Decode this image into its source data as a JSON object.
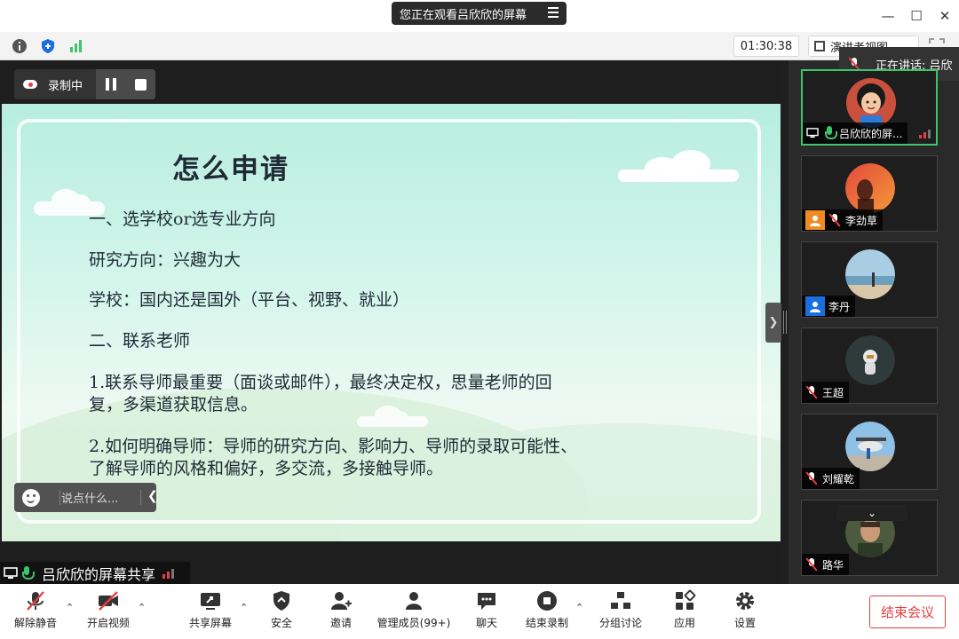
{
  "window": {
    "viewing_banner": "您正在观看吕欣欣的屏幕",
    "minimize": "—",
    "maximize": "☐",
    "close": "✕"
  },
  "inforow": {
    "timer": "01:30:38",
    "view_mode": "演讲者视图"
  },
  "recording": {
    "label": "录制中"
  },
  "slide": {
    "title": "怎么申请",
    "lines": [
      "一、选学校or选专业方向",
      "研究方向：兴趣为大",
      "学校：国内还是国外（平台、视野、就业）",
      "二、联系老师",
      "1.联系导师最重要（面谈或邮件），最终决定权，思量老师的回",
      "复，多渠道获取信息。",
      "2.如何明确导师：导师的研究方向、影响力、导师的录取可能性、",
      "了解导师的风格和偏好，多交流，多接触导师。"
    ]
  },
  "comment": {
    "placeholder": "说点什么..."
  },
  "sharer": {
    "name": "吕欣欣的屏幕共享"
  },
  "speaking": {
    "label": "正在讲话: 吕欣"
  },
  "participants": [
    {
      "name": "吕欣欣的屏...",
      "muted": false,
      "active": true
    },
    {
      "name": "李劲草",
      "muted": true,
      "active": false
    },
    {
      "name": "李丹",
      "muted": false,
      "active": false
    },
    {
      "name": "王超",
      "muted": true,
      "active": false
    },
    {
      "name": "刘耀乾",
      "muted": true,
      "active": false
    },
    {
      "name": "路华",
      "muted": true,
      "active": false
    }
  ],
  "toolbar": {
    "unmute": "解除静音",
    "start_video": "开启视频",
    "share_screen": "共享屏幕",
    "security": "安全",
    "invite": "邀请",
    "manage_members": "管理成员(99+)",
    "chat": "聊天",
    "end_recording": "结束录制",
    "breakout": "分组讨论",
    "apps": "应用",
    "settings": "设置",
    "end_meeting": "结束会议"
  },
  "colors": {
    "accent_green": "#3fc36b",
    "alert_red": "#e54040",
    "share_blue": "#1a6fe0",
    "orange_avatar": "#f08a24"
  }
}
